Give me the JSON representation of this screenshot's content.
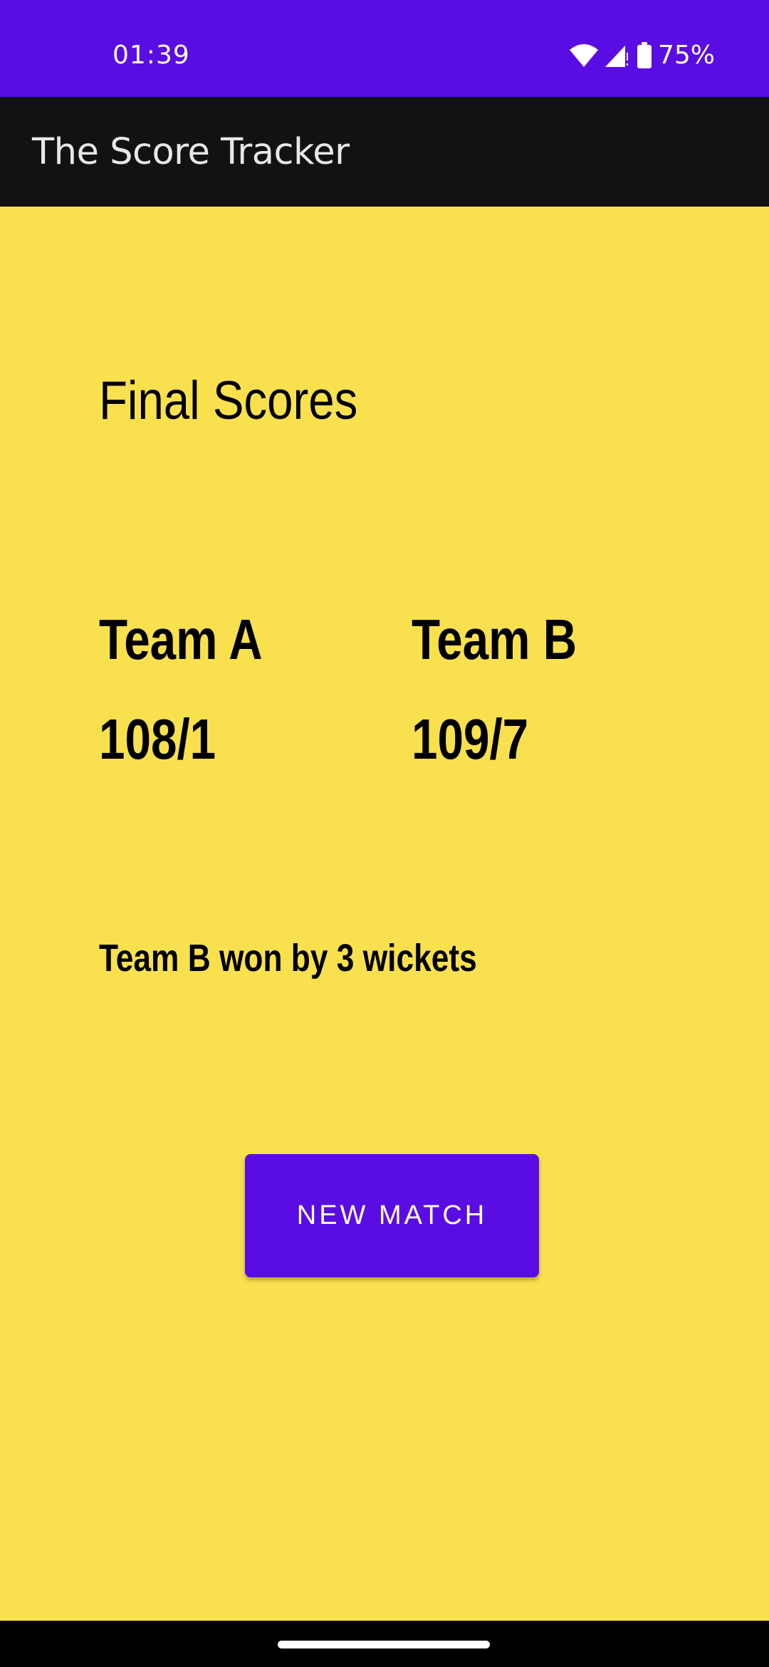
{
  "status_bar": {
    "time": "01:39",
    "battery_percent": "75%",
    "icons": [
      "wifi-icon",
      "signal-icon",
      "battery-icon"
    ],
    "background_color": "#5A0DE2"
  },
  "app_bar": {
    "title": "The Score Tracker",
    "background_color": "#121212"
  },
  "main": {
    "heading": "Final Scores",
    "teams": [
      {
        "name": "Team A",
        "score": "108/1"
      },
      {
        "name": "Team B",
        "score": "109/7"
      }
    ],
    "result": "Team B won by 3 wickets",
    "new_match_label": "NEW MATCH",
    "background_color": "#F9E04F",
    "accent_color": "#5A0DE2"
  }
}
